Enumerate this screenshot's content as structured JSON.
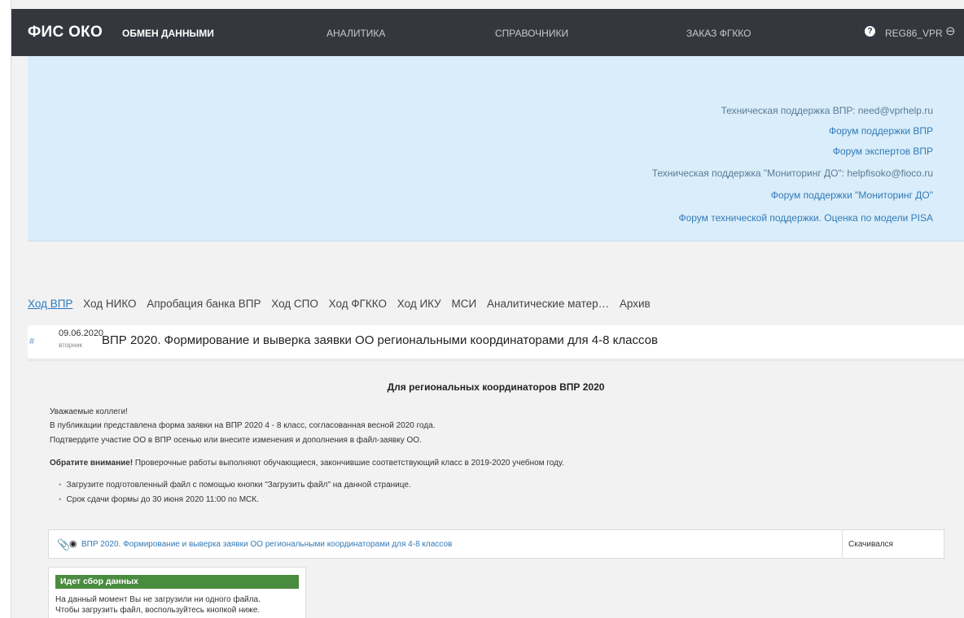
{
  "header": {
    "brand": "ФИС ОКО",
    "nav": [
      "ОБМЕН ДАННЫМИ",
      "АНАЛИТИКА",
      "СПРАВОЧНИКИ",
      "ЗАКАЗ ФГККО"
    ],
    "help_glyph": "?",
    "user": "REG86_VPR",
    "logout_glyph": "⊖"
  },
  "support_links": [
    "Техническая поддержка ВПР: need@vprhelp.ru",
    "Форум поддержки ВПР",
    "Форум экспертов ВПР",
    "Техническая поддержка \"Мониторинг ДО\": helpfisoko@fioco.ru",
    "Форум поддержки \"Мониторинг ДО\"",
    "Форум технической поддержки. Оценка по модели PISA"
  ],
  "tabs": [
    "Ход ВПР",
    "Ход НИКО",
    "Апробация банка ВПР",
    "Ход СПО",
    "Ход ФГККО",
    "Ход ИКУ",
    "МСИ",
    "Аналитические матер…",
    "Архив"
  ],
  "publication": {
    "hash": "#",
    "date": "09.06.2020",
    "day": "вторник",
    "title": "ВПР 2020. Формирование и выверка заявки ОО региональными координаторами для 4-8 классов"
  },
  "content": {
    "heading": "Для региональных координаторов ВПР 2020",
    "para1": "Уважаемые коллеги!",
    "para2": "В публикации представлена форма заявки на ВПР 2020 4 - 8 класс, согласованная весной 2020 года.",
    "para3": "Подтвердите участие ОО в ВПР осенью или внесите изменения и дополнения в файл-заявку ОО.",
    "notice_bold": "Обратите внимание!",
    "notice_rest": " Проверочные работы выполняют обучающиеся, закончившие соответствующий класс в 2019-2020 учебном году.",
    "bullet1": "Загрузите подготовленный файл с помощью кнопки \"Загрузить файл\" на данной странице.",
    "bullet2": "Срок сдачи формы до 30 июня 2020 11:00 по МСК."
  },
  "file": {
    "name": "ВПР 2020. Формирование и выверка заявки ОО региональными координаторами для 4-8 классов",
    "status": "Скачивался"
  },
  "collect": {
    "badge": "Идет сбор данных",
    "line1": "На данный момент Вы не загрузили ни одного файла.",
    "line2": "Чтобы загрузить файл, воспользуйтесь кнопкой ниже."
  },
  "colors": {
    "topbar": "#34373e",
    "info_panel": "#d9eefa",
    "link": "#3379b8",
    "badge_green": "#4a8c3f"
  }
}
